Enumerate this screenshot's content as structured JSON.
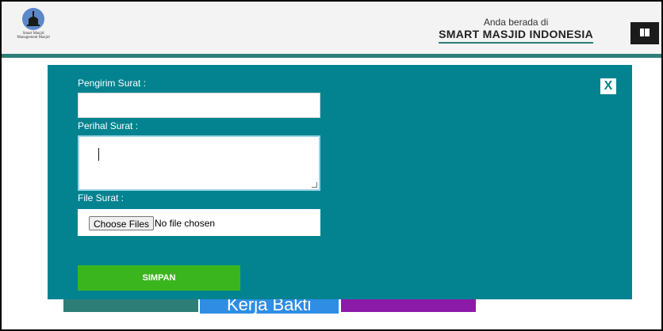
{
  "header": {
    "logo_text_1": "Smart Masjid",
    "logo_text_2": "Management Masjid",
    "location_prefix": "Anda berada di",
    "location_name": "SMART MASJID INDONESIA",
    "menu_icon": "menu-icon"
  },
  "background": {
    "blue_button_label": "Kerja Bakti"
  },
  "modal": {
    "close_label": "X",
    "sender_label": "Pengirim Surat :",
    "sender_value": "",
    "subject_label": "Perihal Surat :",
    "subject_value": "",
    "file_label": "File Surat :",
    "choose_files_label": "Choose Files",
    "file_status": "No file chosen",
    "save_label": "SIMPAN",
    "colors": {
      "modal_bg": "#038390",
      "save_bg": "#3bb51e",
      "header_accent": "#2d7d78"
    }
  }
}
